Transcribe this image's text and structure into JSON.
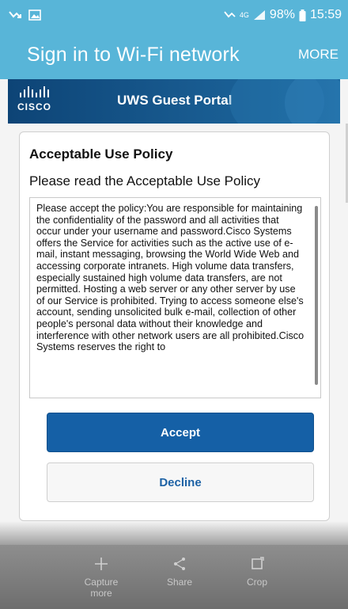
{
  "status_bar": {
    "battery": "98%",
    "time": "15:59"
  },
  "app_bar": {
    "title": "Sign in to Wi-Fi network",
    "more_label": "MORE"
  },
  "portal": {
    "brand": "CISCO",
    "title": "UWS Guest Portal"
  },
  "policy": {
    "heading": "Acceptable Use Policy",
    "subheading": "Please read the Acceptable Use Policy",
    "text": "Please accept the policy:You are responsible for maintaining the confidentiality of the password and all activities that occur under your username and password.Cisco Systems offers the Service for activities such as the active use of e-mail, instant messaging, browsing the World Wide Web and accessing corporate intranets. High volume data transfers, especially sustained high volume data transfers, are not permitted. Hosting a web server or any other server by use of our Service is prohibited. Trying to access someone else's account, sending unsolicited bulk e-mail, collection of other people's personal data without their knowledge and interference with other network users are all prohibited.Cisco Systems reserves the right to"
  },
  "buttons": {
    "accept": "Accept",
    "decline": "Decline"
  },
  "toolbar": {
    "capture_more": "Capture more",
    "share": "Share",
    "crop": "Crop"
  },
  "colors": {
    "app_bar": "#58b5d8",
    "accept_button": "#1560a6",
    "portal_header": "#185a8f"
  }
}
